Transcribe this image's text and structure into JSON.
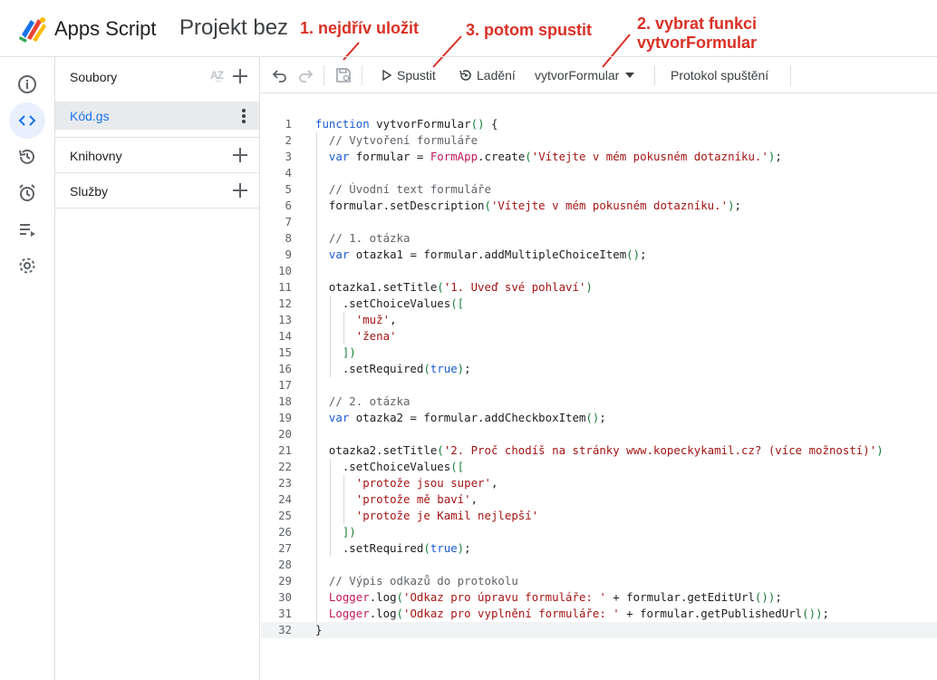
{
  "header": {
    "app_name": "Apps Script",
    "project_name": "Projekt bez"
  },
  "annotations": {
    "save": "1. nejdřív uložit",
    "select_line1": "2. vybrat funkci",
    "select_line2": "vytvorFormular",
    "run": "3. potom spustit",
    "color": "#d93025"
  },
  "rail": {
    "items": [
      "info-icon",
      "code-icon",
      "history-icon",
      "alarm-icon",
      "executions-icon",
      "settings-icon"
    ],
    "active": "code-icon"
  },
  "files": {
    "section_files": "Soubory",
    "file_name": "Kód.gs",
    "section_libraries": "Knihovny",
    "section_services": "Služby"
  },
  "toolbar": {
    "run_label": "Spustit",
    "debug_label": "Ladění",
    "function_name": "vytvorFormular",
    "log_label": "Protokol spuštění"
  },
  "code_lines": [
    "function vytvorFormular() {",
    "  // Vytvoření formuláře",
    "  var formular = FormApp.create('Vítejte v mém pokusném dotazníku.');",
    "",
    "  // Úvodní text formuláře",
    "  formular.setDescription('Vítejte v mém pokusném dotazníku.');",
    "",
    "  // 1. otázka",
    "  var otazka1 = formular.addMultipleChoiceItem();",
    "",
    "  otazka1.setTitle('1. Uveď své pohlaví')",
    "    .setChoiceValues([",
    "      'muž',",
    "      'žena'",
    "    ])",
    "    .setRequired(true);",
    "",
    "  // 2. otázka",
    "  var otazka2 = formular.addCheckboxItem();",
    "",
    "  otazka2.setTitle('2. Proč chodíš na stránky www.kopeckykamil.cz? (více možností)')",
    "    .setChoiceValues([",
    "      'protože jsou super',",
    "      'protože mě baví',",
    "      'protože je Kamil nejlepší'",
    "    ])",
    "    .setRequired(true);",
    "",
    "  // Výpis odkazů do protokolu",
    "  Logger.log('Odkaz pro úpravu formuláře: ' + formular.getEditUrl());",
    "  Logger.log('Odkaz pro vyplnění formuláře: ' + formular.getPublishedUrl());",
    "}"
  ],
  "current_line": 32
}
